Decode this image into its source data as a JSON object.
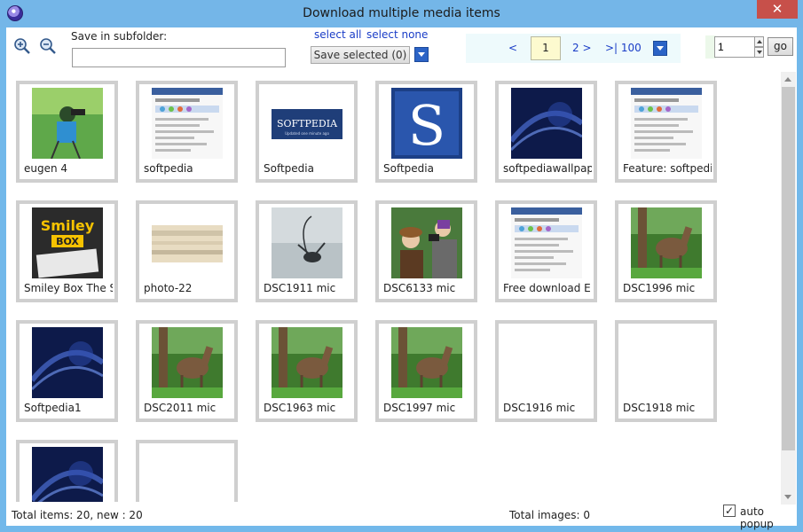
{
  "window": {
    "title": "Download multiple media items",
    "close_glyph": "✕"
  },
  "toolbar": {
    "subfolder_label": "Save in subfolder:",
    "subfolder_value": "",
    "select_all": "select all",
    "select_none": "select none",
    "save_selected": "Save selected (0)"
  },
  "pager": {
    "prev": "<",
    "current": "1",
    "next": "2 >",
    "last": ">| 100"
  },
  "goto": {
    "value": "1",
    "go_label": "go"
  },
  "items": [
    {
      "label": "eugen 4",
      "thumb": "photographer-icon"
    },
    {
      "label": "softpedia",
      "thumb": "webpage-icon"
    },
    {
      "label": "Softpedia",
      "thumb": "softpedia-logo-icon"
    },
    {
      "label": "Softpedia",
      "thumb": "softpedia-s-icon"
    },
    {
      "label": "softpediawallpape",
      "thumb": "wallpaper-icon"
    },
    {
      "label": "Feature: softpedia.",
      "thumb": "webpage-icon"
    },
    {
      "label": "Smiley Box The So",
      "thumb": "smiley-box-icon"
    },
    {
      "label": "photo-22",
      "thumb": "photo-icon"
    },
    {
      "label": "DSC1911 mic",
      "thumb": "insect-icon"
    },
    {
      "label": "DSC6133 mic",
      "thumb": "people-icon"
    },
    {
      "label": "Free download E..",
      "thumb": "webpage-icon"
    },
    {
      "label": "DSC1996 mic",
      "thumb": "horse-icon"
    },
    {
      "label": "Softpedia1",
      "thumb": "wallpaper-icon"
    },
    {
      "label": "DSC2011 mic",
      "thumb": "horse-icon"
    },
    {
      "label": "DSC1963 mic",
      "thumb": "horse-icon"
    },
    {
      "label": "DSC1997 mic",
      "thumb": "horse-icon"
    },
    {
      "label": "DSC1916 mic",
      "thumb": ""
    },
    {
      "label": "DSC1918 mic",
      "thumb": ""
    },
    {
      "label": "",
      "thumb": "wallpaper-icon"
    },
    {
      "label": "",
      "thumb": ""
    }
  ],
  "status": {
    "total_items": "Total items: 20, new : 20",
    "total_images": "Total images: 0",
    "auto_popup": "auto popup",
    "auto_popup_checked": "✓"
  }
}
